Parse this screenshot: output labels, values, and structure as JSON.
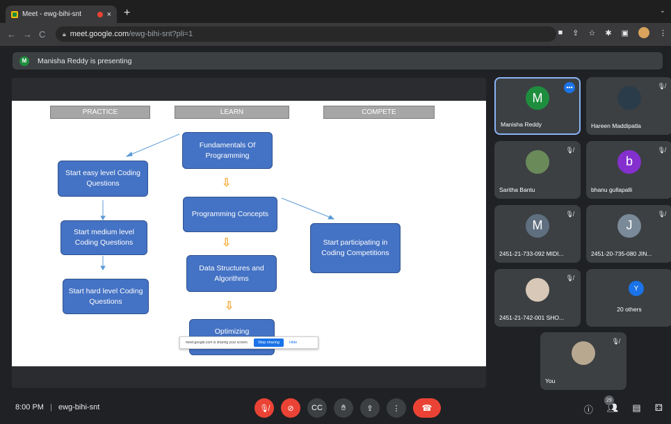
{
  "browser": {
    "tab_title": "Meet - ewg-bihi-snt",
    "tab_close": "×",
    "new_tab": "+",
    "url_domain": "meet.google.com",
    "url_path": "/ewg-bihi-snt?pli=1"
  },
  "presenting_banner": {
    "avatar_letter": "M",
    "text": "Manisha Reddy is presenting"
  },
  "slide": {
    "headers": [
      "PRACTICE",
      "LEARN",
      "COMPETE"
    ],
    "practice": [
      "Start easy level Coding Questions",
      "Start medium level Coding Questions",
      "Start hard level Coding Questions"
    ],
    "learn": [
      "Fundamentals Of Programming",
      "Programming Concepts",
      "Data Structures and Algorithms",
      "Optimizing"
    ],
    "compete": [
      "Start participating in Coding Competitions"
    ]
  },
  "share_toast": {
    "text": "meet.google.com is sharing your screen.",
    "stop": "Stop sharing",
    "hide": "Hide"
  },
  "participants": [
    {
      "name": "Manisha Reddy",
      "letter": "M",
      "color": "#1e8e3e"
    },
    {
      "name": "Hareen Maddipatla",
      "letter": "",
      "color": "#2a3b4a"
    },
    {
      "name": "Saritha Bantu",
      "letter": "",
      "color": "#6a8a5a"
    },
    {
      "name": "bhanu gullapalli",
      "letter": "b",
      "color": "#8430ce"
    },
    {
      "name": "2451-21-733-092 MIDI...",
      "letter": "M",
      "color": "#5f6f7f"
    },
    {
      "name": "2451-20-735-080 JIN...",
      "letter": "J",
      "color": "#7a8a99"
    },
    {
      "name": "2451-21-742-001 SHO...",
      "letter": "",
      "color": "#d8c8b8"
    },
    {
      "name": "20 others",
      "letter": "Y",
      "color": "#1a73e8"
    },
    {
      "name": "You",
      "letter": "",
      "color": "#b8a890"
    }
  ],
  "meeting": {
    "time": "8:00 PM",
    "separator": "|",
    "code": "ewg-bihi-snt",
    "people_count": "29"
  },
  "icons": {
    "mic": "mic-off-icon",
    "cam": "cam-off-icon",
    "cc": "captions-icon",
    "hand": "raise-hand-icon",
    "present": "present-icon",
    "more": "more-icon",
    "end": "end-call-icon",
    "info": "info-icon",
    "people": "people-icon",
    "chat": "chat-icon",
    "activities": "activities-icon"
  }
}
